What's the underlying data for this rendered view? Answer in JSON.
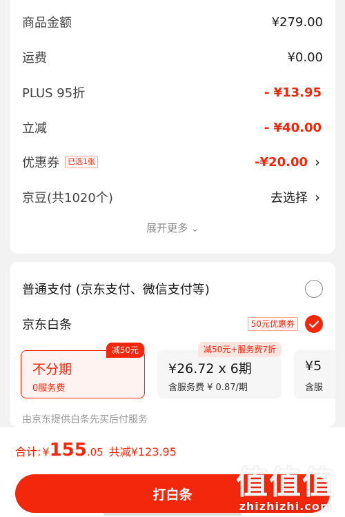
{
  "summary": {
    "rows": [
      {
        "label": "商品金额",
        "value": "¥279.00"
      },
      {
        "label": "运费",
        "value": "¥0.00"
      },
      {
        "label": "PLUS 95折",
        "value": "- ¥13.95"
      },
      {
        "label": "立减",
        "value": "- ¥40.00"
      },
      {
        "label": "优惠券",
        "tag": "已选1张",
        "value": "-¥20.00"
      },
      {
        "label": "京豆(共1020个)",
        "value": "去选择"
      }
    ],
    "expand_label": "展开更多"
  },
  "payment": {
    "normal_label": "普通支付 (京东支付、微信支付等)",
    "baitiao_label": "京东白条",
    "coupon_tag": "50元优惠券",
    "plans": [
      {
        "title": "不分期",
        "sub": "0服务费",
        "badge": "减50元",
        "selected": true
      },
      {
        "title": "¥26.72 x 6期",
        "sub": "含服务费 ¥ 0.87/期",
        "badge": "减50元+服务费7折",
        "selected": false
      },
      {
        "title": "¥5",
        "sub": "含服",
        "selected": false
      }
    ],
    "note": "由京东提供白条先买后付服务"
  },
  "footer": {
    "total_label": "合计:",
    "currency": "¥",
    "total_int": "155",
    "total_dec": ".05",
    "saved": "共减¥123.95",
    "cta_label": "打白条"
  },
  "watermark": {
    "glyphs": "值值值",
    "site": "zhizhizhi.com"
  },
  "colors": {
    "accent": "#f2270c",
    "bg": "#f2f2f2"
  }
}
